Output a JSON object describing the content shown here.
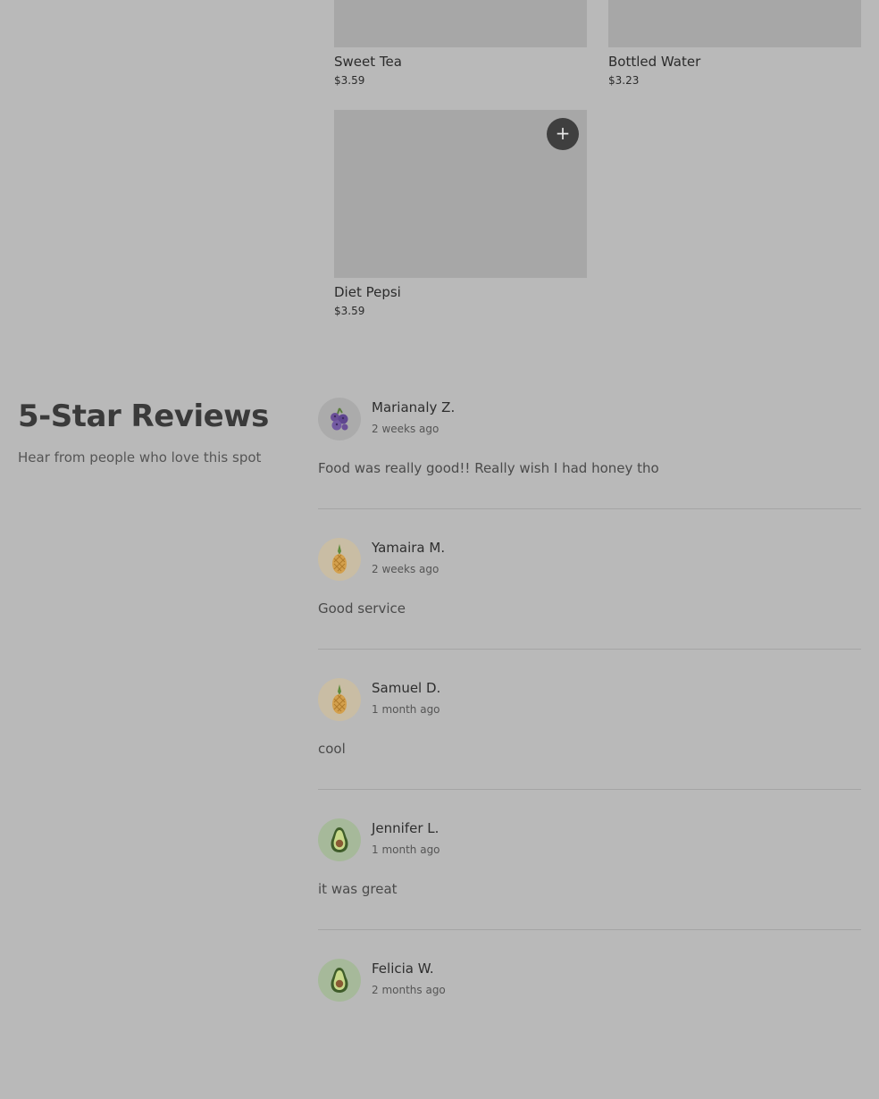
{
  "menu": {
    "items": [
      {
        "name": "Sweet Tea",
        "price": "$3.59"
      },
      {
        "name": "Bottled Water",
        "price": "$3.23"
      },
      {
        "name": "Diet Pepsi",
        "price": "$3.59"
      }
    ],
    "add_icon": "plus-icon"
  },
  "reviews": {
    "title": "5-Star Reviews",
    "subtitle": "Hear from people who love this spot",
    "list": [
      {
        "name": "Marianaly Z.",
        "date": "2 weeks ago",
        "text": "Food was really good!! Really wish I had honey tho",
        "avatar": "blueberries-icon"
      },
      {
        "name": "Yamaira M.",
        "date": "2 weeks ago",
        "text": "Good service",
        "avatar": "pineapple-icon"
      },
      {
        "name": "Samuel D.",
        "date": "1 month ago",
        "text": "cool",
        "avatar": "pineapple-icon"
      },
      {
        "name": "Jennifer L.",
        "date": "1 month ago",
        "text": "it was great",
        "avatar": "avocado-icon"
      },
      {
        "name": "Felicia W.",
        "date": "2 months ago",
        "text": "",
        "avatar": "avocado-icon"
      }
    ]
  },
  "colors": {
    "overlay_background": "#b9b9b9",
    "image_placeholder": "#a7a7a7",
    "add_button": "#3f3f3f",
    "pineapple_bg": "#c9bda4",
    "avocado_bg": "#a6b99a",
    "blueberry_bg": "#ababab"
  }
}
